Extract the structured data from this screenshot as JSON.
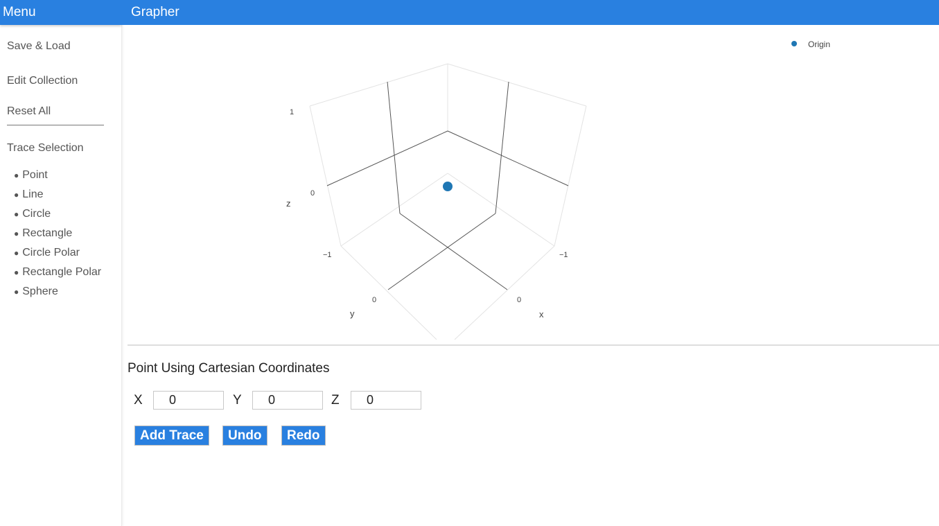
{
  "sidebar": {
    "header": "Menu",
    "links": [
      {
        "label": "Save & Load"
      },
      {
        "label": "Edit Collection"
      },
      {
        "label": "Reset All"
      },
      {
        "label": "Trace Selection"
      }
    ],
    "trace_items": [
      {
        "label": "Point"
      },
      {
        "label": "Line"
      },
      {
        "label": "Circle"
      },
      {
        "label": "Rectangle"
      },
      {
        "label": "Circle Polar"
      },
      {
        "label": "Rectangle Polar"
      },
      {
        "label": "Sphere"
      }
    ]
  },
  "header": {
    "title": "Grapher"
  },
  "chart_data": {
    "type": "scatter",
    "title": "",
    "series": [
      {
        "name": "Origin",
        "color": "#1f77b4",
        "points": [
          {
            "x": 0,
            "y": 0,
            "z": 0
          }
        ]
      }
    ],
    "axes": {
      "x": {
        "label": "x",
        "ticks": [
          "−1",
          "0"
        ]
      },
      "y": {
        "label": "y",
        "ticks": [
          "−1",
          "0"
        ]
      },
      "z": {
        "label": "z",
        "ticks": [
          "−1",
          "0",
          "1"
        ]
      }
    },
    "legend_position": "top-right",
    "grid": true
  },
  "form": {
    "title": "Point Using Cartesian Coordinates",
    "x_label": "X",
    "x_value": "0",
    "y_label": "Y",
    "y_value": "0",
    "z_label": "Z",
    "z_value": "0",
    "add_label": "Add Trace",
    "undo_label": "Undo",
    "redo_label": "Redo"
  },
  "colors": {
    "accent": "#2980e0",
    "trace": "#1f77b4"
  }
}
